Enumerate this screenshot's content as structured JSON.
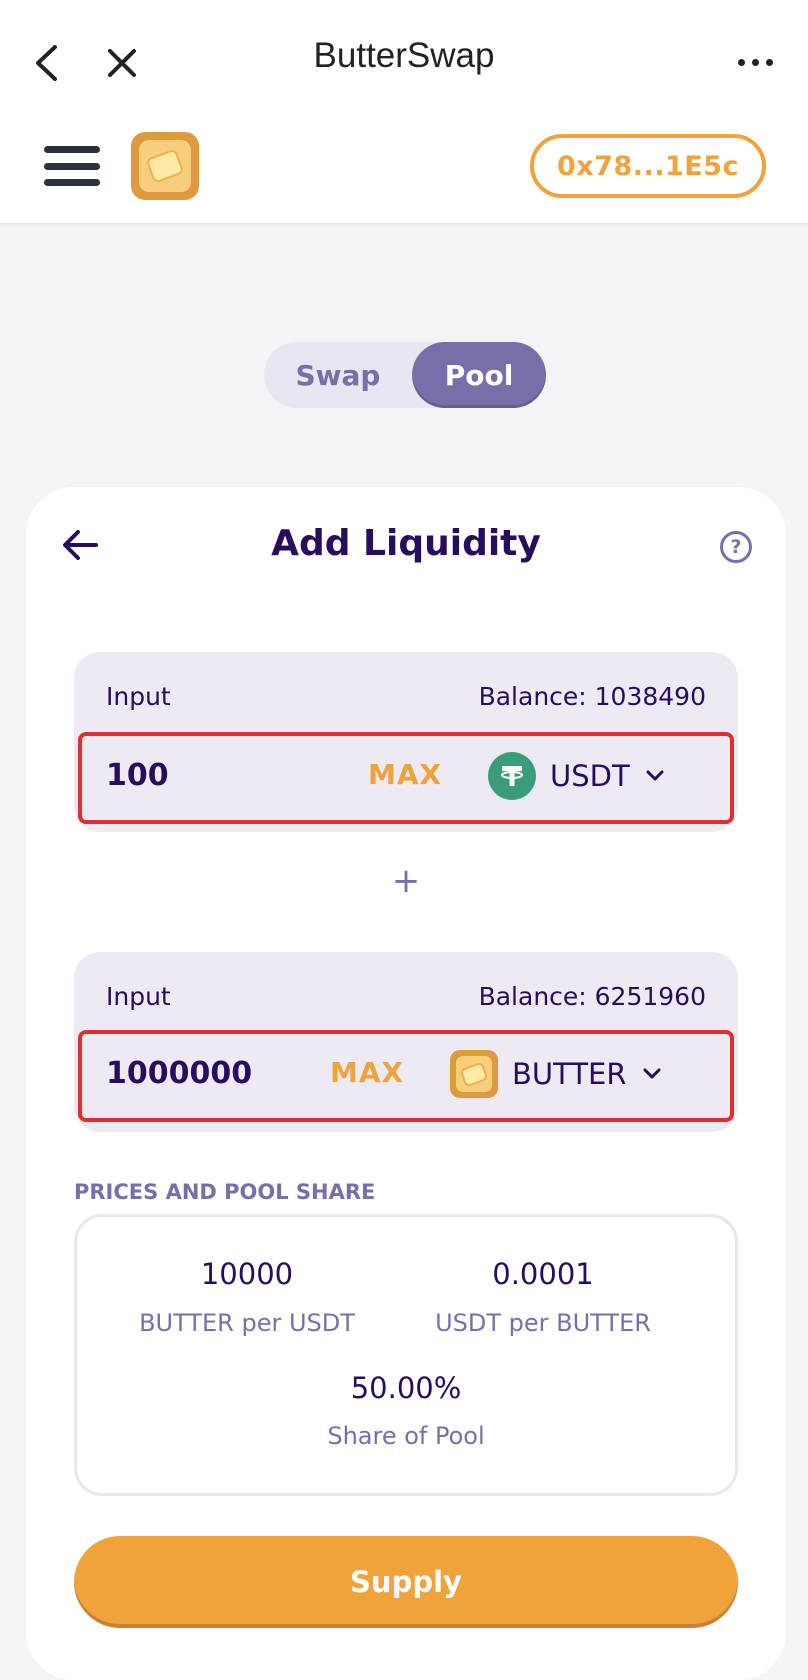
{
  "browser": {
    "title": "ButterSwap"
  },
  "header": {
    "wallet_address": "0x78...1E5c"
  },
  "toggle": {
    "swap_label": "Swap",
    "pool_label": "Pool",
    "active": "Pool"
  },
  "card": {
    "title": "Add Liquidity",
    "help_symbol": "?",
    "plus_symbol": "+",
    "inputs": [
      {
        "label": "Input",
        "balance": "Balance: 1038490",
        "value": "100",
        "max_label": "MAX",
        "token": "USDT",
        "token_icon": "usdt-icon"
      },
      {
        "label": "Input",
        "balance": "Balance: 6251960",
        "value": "1000000",
        "max_label": "MAX",
        "token": "BUTTER",
        "token_icon": "butter-icon"
      }
    ],
    "prices_section_label": "PRICES AND POOL SHARE",
    "prices": {
      "rate1_value": "10000",
      "rate1_label": "BUTTER per USDT",
      "rate2_value": "0.0001",
      "rate2_label": "USDT per BUTTER",
      "share_value": "50.00%",
      "share_label": "Share of Pool"
    },
    "supply_label": "Supply"
  },
  "colors": {
    "accent": "#f0a33a",
    "primary_text": "#280d5f",
    "secondary_text": "#7a6eaa",
    "highlight_border": "#e0302e"
  }
}
